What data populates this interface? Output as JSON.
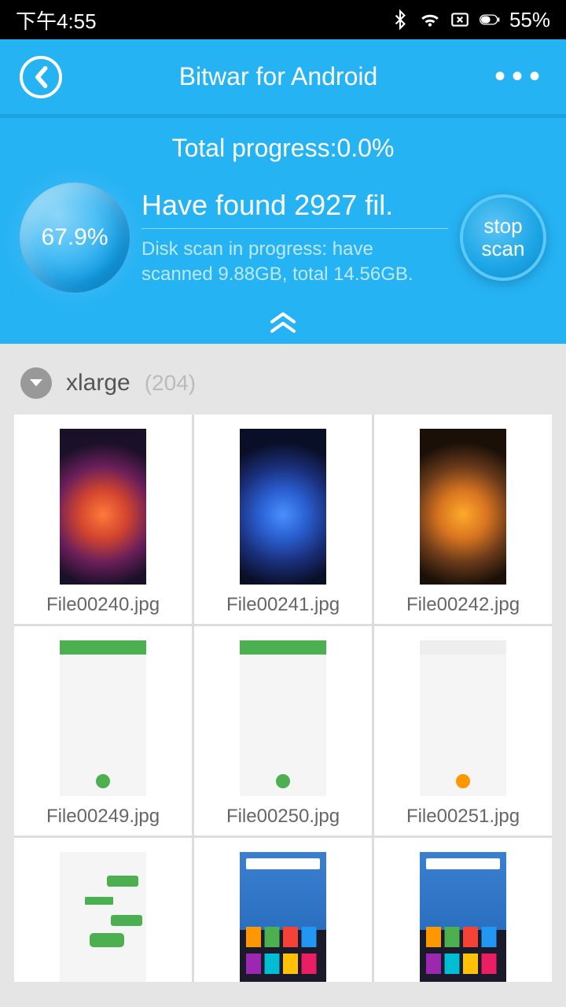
{
  "status": {
    "time": "下午4:55",
    "battery": "55%"
  },
  "header": {
    "title": "Bitwar for Android"
  },
  "progress": {
    "total_label": "Total progress:0.0%",
    "orb_percent": "67.9%",
    "found_text": "Have found 2927 fil.",
    "scan_status": "Disk scan in progress: have scanned 9.88GB, total 14.56GB.",
    "stop_line1": "stop",
    "stop_line2": "scan"
  },
  "group": {
    "name": "xlarge",
    "count": "(204)"
  },
  "files": [
    {
      "name": "File00240.jpg",
      "kind": "red"
    },
    {
      "name": "File00241.jpg",
      "kind": "blue"
    },
    {
      "name": "File00242.jpg",
      "kind": "orange"
    },
    {
      "name": "File00249.jpg",
      "kind": "app"
    },
    {
      "name": "File00250.jpg",
      "kind": "app"
    },
    {
      "name": "File00251.jpg",
      "kind": "app doc"
    },
    {
      "name": "",
      "kind": "chat"
    },
    {
      "name": "",
      "kind": "home"
    },
    {
      "name": "",
      "kind": "home"
    }
  ]
}
